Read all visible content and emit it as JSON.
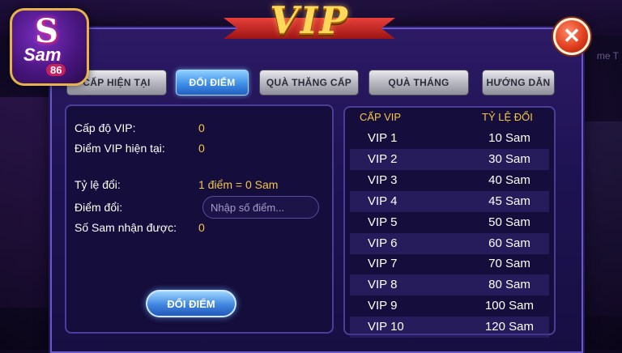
{
  "header": {
    "title": "VIP",
    "logo_main": "S",
    "logo_sub": "Sam",
    "logo_num": "86",
    "bg_label": "me T"
  },
  "tabs": [
    {
      "label": "CẤP HIỆN TẠI",
      "active": false
    },
    {
      "label": "ĐỔI ĐIỂM",
      "active": true
    },
    {
      "label": "QUÀ THĂNG CẤP",
      "active": false
    },
    {
      "label": "QUÀ THÁNG",
      "active": false
    },
    {
      "label": "HƯỚNG DẪN",
      "active": false
    }
  ],
  "exchange": {
    "vip_level_label": "Cấp độ VIP:",
    "vip_level_value": "0",
    "vip_points_label": "Điểm VIP hiện tại:",
    "vip_points_value": "0",
    "rate_label": "Tỷ lệ đổi:",
    "rate_value": "1 điểm = 0 Sam",
    "points_label": "Điểm đổi:",
    "points_placeholder": "Nhập số điểm...",
    "received_label": "Số Sam nhận được:",
    "received_value": "0",
    "button_label": "ĐỔI ĐIỂM"
  },
  "rate_table": {
    "headers": [
      "CẤP VIP",
      "TỶ LỆ ĐỔI"
    ],
    "rows": [
      {
        "level": "VIP 1",
        "rate": "10 Sam"
      },
      {
        "level": "VIP 2",
        "rate": "30 Sam"
      },
      {
        "level": "VIP 3",
        "rate": "40 Sam"
      },
      {
        "level": "VIP 4",
        "rate": "45 Sam"
      },
      {
        "level": "VIP 5",
        "rate": "50 Sam"
      },
      {
        "level": "VIP 6",
        "rate": "60 Sam"
      },
      {
        "level": "VIP 7",
        "rate": "70 Sam"
      },
      {
        "level": "VIP 8",
        "rate": "80 Sam"
      },
      {
        "level": "VIP 9",
        "rate": "100 Sam"
      },
      {
        "level": "VIP 10",
        "rate": "120 Sam"
      }
    ]
  },
  "colors": {
    "accent_gold": "#f3c64a",
    "active_tab": "#3f8fe8",
    "close_red": "#e0401f"
  },
  "icons": {
    "close": "close-icon"
  }
}
